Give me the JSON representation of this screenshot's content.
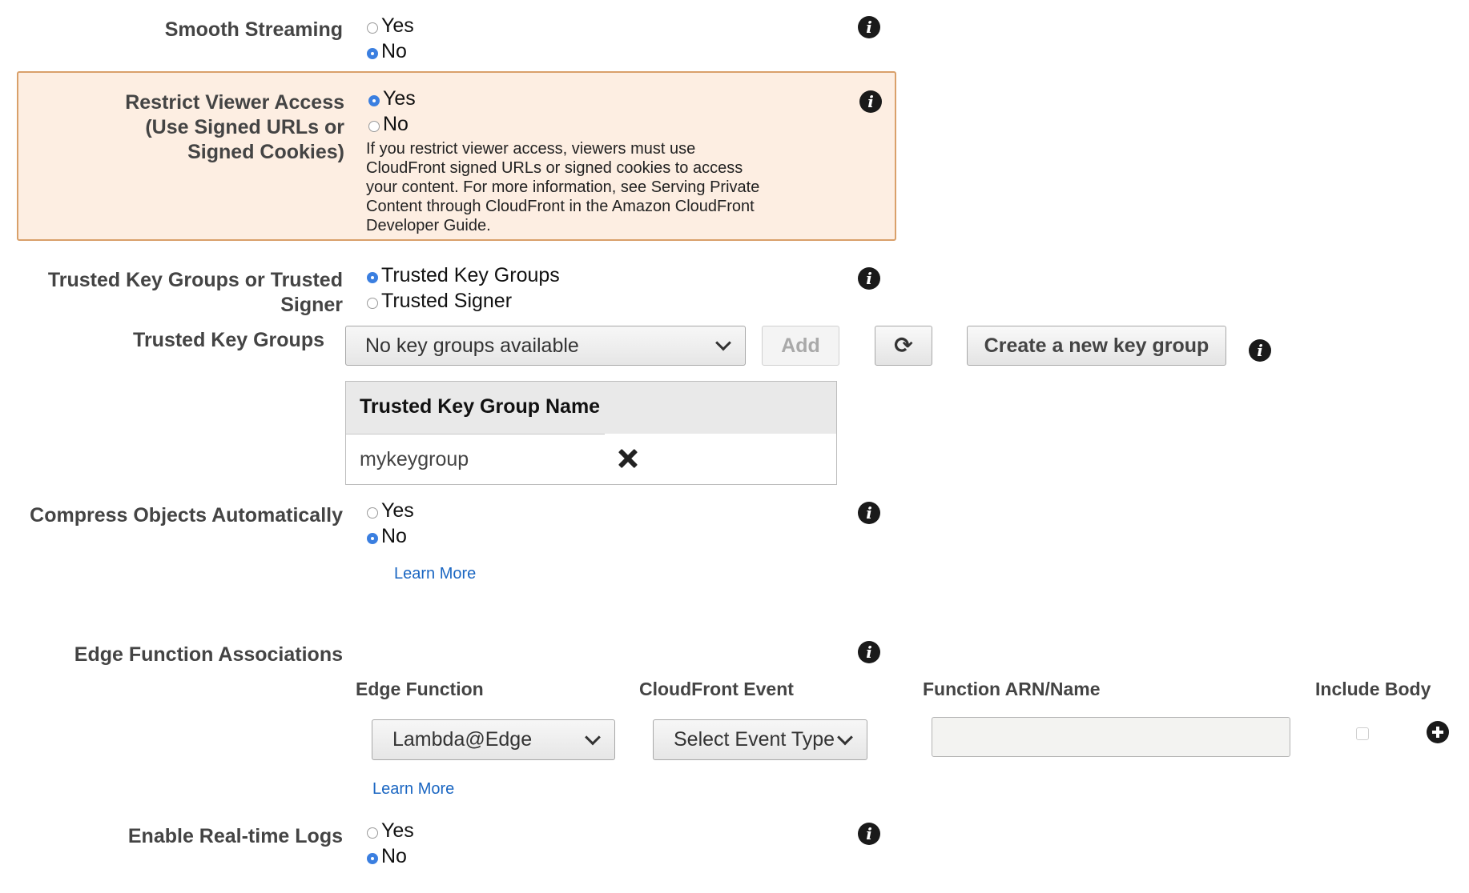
{
  "smooth_streaming": {
    "label": "Smooth Streaming",
    "options": [
      "Yes",
      "No"
    ],
    "selected": "No"
  },
  "restrict_viewer_access": {
    "label_line1": "Restrict Viewer Access",
    "label_line2": "(Use Signed URLs or",
    "label_line3": "Signed Cookies)",
    "options": [
      "Yes",
      "No"
    ],
    "selected": "Yes",
    "help_line1": "If you restrict viewer access, viewers must use",
    "help_line2": "CloudFront signed URLs or signed cookies to access",
    "help_line3": "your content. For more information, see Serving Private",
    "help_line4": "Content through CloudFront in the Amazon CloudFront",
    "help_line5": "Developer Guide."
  },
  "trusted_choice": {
    "label_line1": "Trusted Key Groups or Trusted",
    "label_line2": "Signer",
    "options": [
      "Trusted Key Groups",
      "Trusted Signer"
    ],
    "selected": "Trusted Key Groups"
  },
  "trusted_key_groups": {
    "label": "Trusted Key Groups",
    "select_value": "No key groups available",
    "add_label": "Add",
    "create_label": "Create a new key group",
    "table_header": "Trusted Key Group Name",
    "rows": [
      "mykeygroup"
    ]
  },
  "compress_objects": {
    "label": "Compress Objects Automatically",
    "options": [
      "Yes",
      "No"
    ],
    "selected": "No",
    "learn_more": "Learn More"
  },
  "edge_functions": {
    "label": "Edge Function Associations",
    "col_edge_function": "Edge Function",
    "col_cloudfront_event": "CloudFront Event",
    "col_function_arn": "Function ARN/Name",
    "col_include_body": "Include Body",
    "edge_function_value": "Lambda@Edge",
    "event_value": "Select Event Type",
    "arn_value": "",
    "learn_more": "Learn More"
  },
  "realtime_logs": {
    "label": "Enable Real-time Logs",
    "options": [
      "Yes",
      "No"
    ],
    "selected": "No"
  },
  "icons": {
    "info": "info-icon",
    "remove": "close-icon",
    "add": "plus-circle-icon",
    "refresh": "refresh-icon",
    "dropdown": "chevron-down-icon"
  },
  "colors": {
    "highlight_bg": "#fdeee2",
    "highlight_border": "#d9a06a",
    "radio_selected": "#3b7fe0",
    "link": "#1a66c2"
  }
}
